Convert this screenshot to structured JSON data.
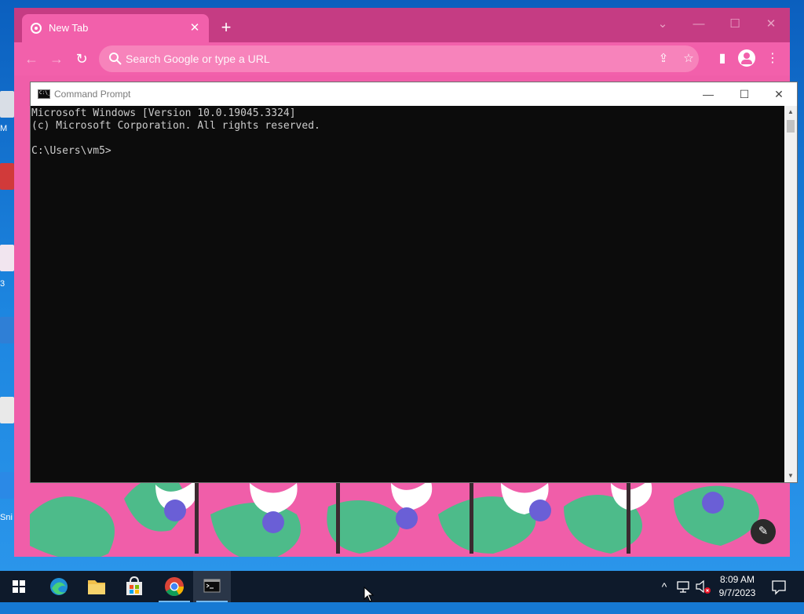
{
  "desktop": {
    "icon_labels": [
      "M",
      "3",
      "Sni"
    ]
  },
  "browser": {
    "tab_title": "New Tab",
    "omnibox_placeholder": "Search Google or type a URL",
    "accent": "#f260ab",
    "titlebar_color": "#c53c83"
  },
  "cmd": {
    "title": "Command Prompt",
    "lines": [
      "Microsoft Windows [Version 10.0.19045.3324]",
      "(c) Microsoft Corporation. All rights reserved.",
      "",
      "C:\\Users\\vm5>"
    ]
  },
  "taskbar": {
    "apps": [
      {
        "name": "Microsoft Edge",
        "icon": "edge-icon",
        "running": false
      },
      {
        "name": "File Explorer",
        "icon": "folder-icon",
        "running": false
      },
      {
        "name": "Microsoft Store",
        "icon": "store-icon",
        "running": false
      },
      {
        "name": "Google Chrome",
        "icon": "chrome-icon",
        "running": true
      },
      {
        "name": "Command Prompt",
        "icon": "cmd-icon",
        "running": true
      }
    ],
    "clock": {
      "time": "8:09 AM",
      "date": "9/7/2023"
    }
  }
}
